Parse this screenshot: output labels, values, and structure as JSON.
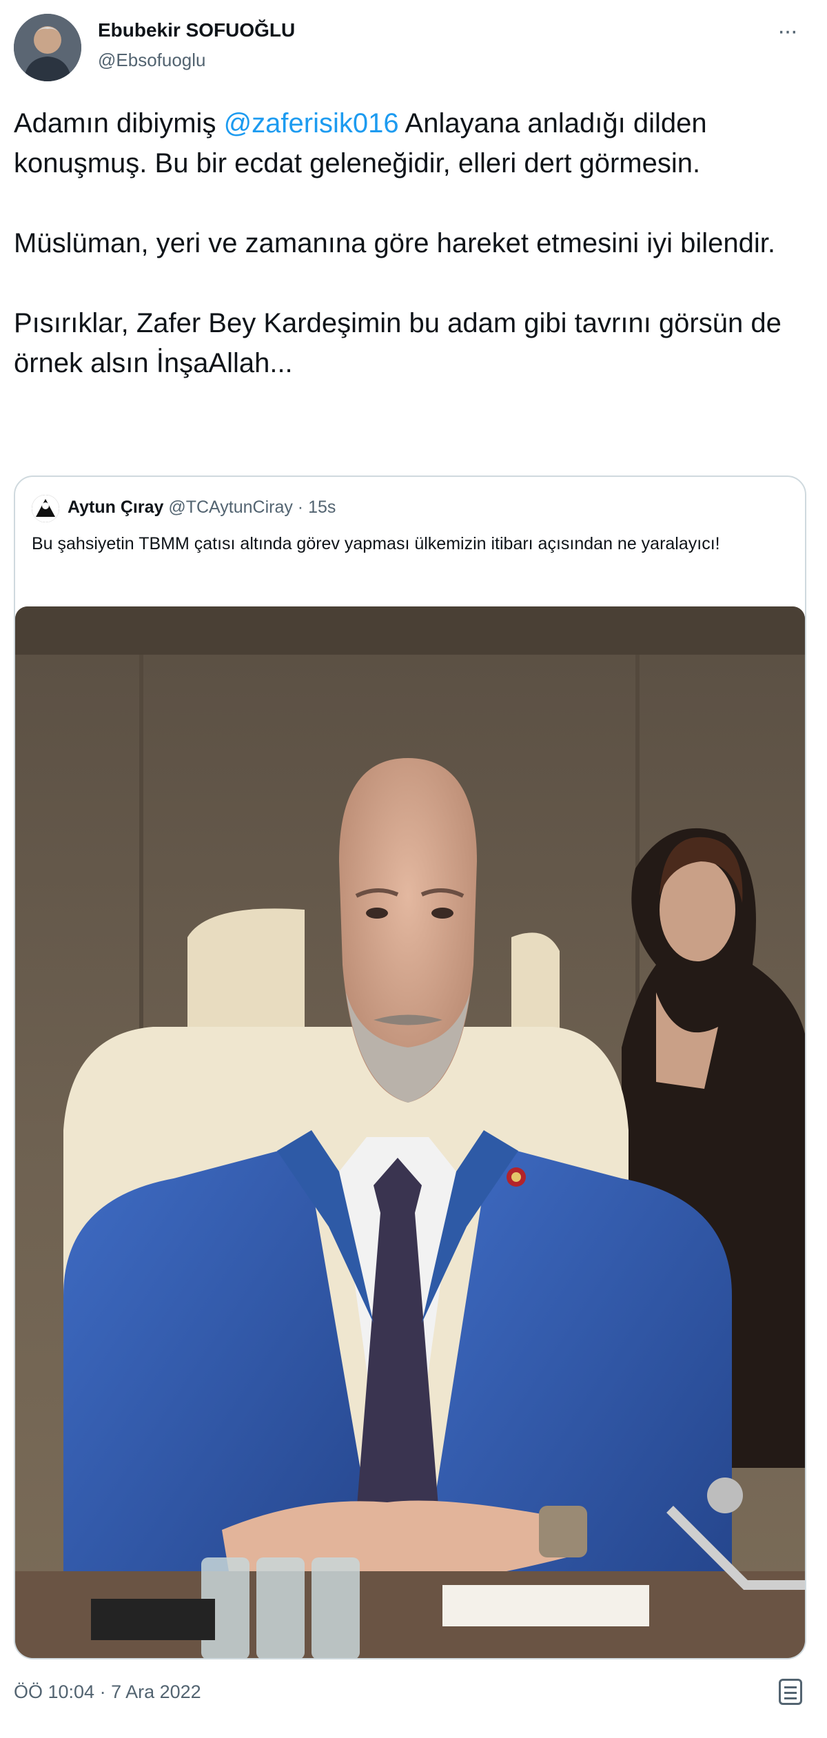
{
  "author": {
    "name": "Ebubekir SOFUOĞLU",
    "handle": "@Ebsofuoglu"
  },
  "tweet": {
    "intro": "Adamın dibiymiş ",
    "mention": "@zaferisik016",
    "body": " Anlayana anladığı dilden konuşmuş. Bu bir ecdat geleneğidir, elleri dert görmesin.\n\nMüslüman, yeri ve zamanına göre hareket etmesini iyi bilendir.\n\nPısırıklar, Zafer Bey Kardeşimin bu adam gibi tavrını görsün de örnek alsın İnşaAllah..."
  },
  "quote": {
    "name": "Aytun Çıray",
    "meta": " @TCAytunCiray · 15s",
    "text": "Bu şahsiyetin TBMM çatısı altında görev yapması ülkemizin itibarı açısından ne yaralayıcı!"
  },
  "timestamp": "ÖÖ 10:04 · 7 Ara 2022",
  "icons": {
    "more": "more-options-icon",
    "app": "app-source-icon"
  },
  "colors": {
    "accent": "#1d9bf0",
    "secondary_text": "#536471",
    "border": "#cfd9de"
  }
}
